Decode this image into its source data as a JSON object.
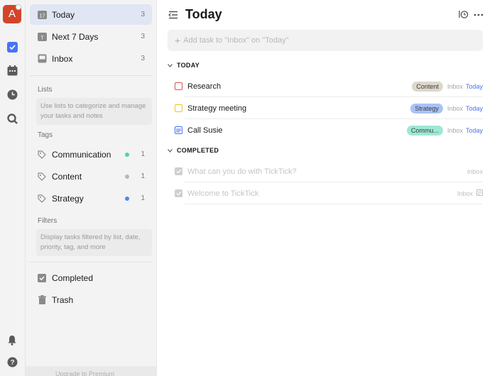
{
  "rail": {
    "avatar_letter": "A"
  },
  "sidebar": {
    "smart_lists": [
      {
        "label": "Today",
        "count": "3",
        "icon": "calendar-today-icon"
      },
      {
        "label": "Next 7 Days",
        "count": "3",
        "icon": "calendar-week-icon"
      },
      {
        "label": "Inbox",
        "count": "3",
        "icon": "inbox-icon"
      }
    ],
    "lists_title": "Lists",
    "lists_hint": "Use lists to categorize and manage your tasks and notes",
    "tags_title": "Tags",
    "tags": [
      {
        "label": "Communication",
        "count": "1",
        "color": "#4fd1b5"
      },
      {
        "label": "Content",
        "count": "1",
        "color": "#c4b5a3"
      },
      {
        "label": "Strategy",
        "count": "1",
        "color": "#4f86f7"
      }
    ],
    "filters_title": "Filters",
    "filters_hint": "Display tasks filtered by list, date, priority, tag, and more",
    "completed_label": "Completed",
    "trash_label": "Trash",
    "premium_label": "Upgrade to Premium"
  },
  "main": {
    "title": "Today",
    "add_placeholder": "Add task to \"Inbox\" on \"Today\"",
    "today_group": "TODAY",
    "completed_group": "COMPLETED",
    "tasks": [
      {
        "title": "Research",
        "tag": "Content",
        "tag_bg": "#ddd7cc",
        "list": "Inbox",
        "date": "Today",
        "box_color": "#d9534f"
      },
      {
        "title": "Strategy meeting",
        "tag": "Strategy",
        "tag_bg": "#a9c2f7",
        "list": "Inbox",
        "date": "Today",
        "box_color": "#f0c430"
      },
      {
        "title": "Call Susie",
        "tag": "Commu...",
        "tag_bg": "#9ee8d4",
        "list": "Inbox",
        "date": "Today",
        "box_color": "#4772fa"
      }
    ],
    "completed_tasks": [
      {
        "title": "What can you do with TickTick?",
        "list": "Inbox"
      },
      {
        "title": "Welcome to TickTick",
        "list": "Inbox"
      }
    ]
  }
}
